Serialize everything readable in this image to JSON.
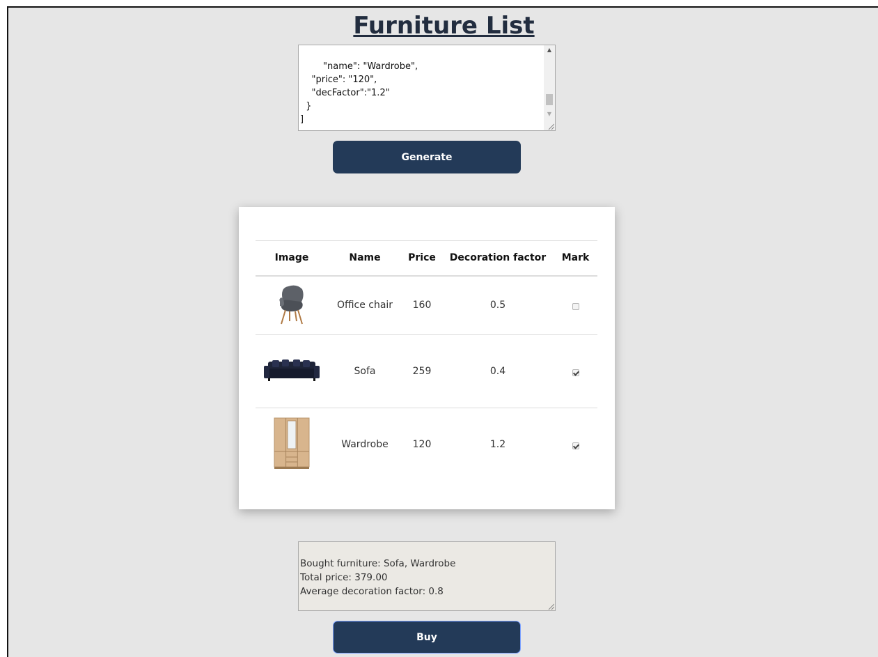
{
  "page": {
    "title": "Furniture List"
  },
  "json_input": {
    "value": "    \"name\": \"Wardrobe\",\n    \"price\": \"120\",\n    \"decFactor\":\"1.2\"\n  }\n]"
  },
  "buttons": {
    "generate_label": "Generate",
    "buy_label": "Buy"
  },
  "table": {
    "headers": [
      "Image",
      "Name",
      "Price",
      "Decoration factor",
      "Mark"
    ],
    "rows": [
      {
        "image": "armchair-image",
        "name": "Office chair",
        "price": "160",
        "decFactor": "0.5",
        "checked": false
      },
      {
        "image": "sofa-image",
        "name": "Sofa",
        "price": "259",
        "decFactor": "0.4",
        "checked": true
      },
      {
        "image": "wardrobe-image",
        "name": "Wardrobe",
        "price": "120",
        "decFactor": "1.2",
        "checked": true
      }
    ]
  },
  "result": {
    "text": "Bought furniture: Sofa, Wardrobe\nTotal price: 379.00\nAverage decoration factor: 0.8"
  },
  "colors": {
    "accent": "#233a58",
    "background": "#e6e6e6"
  }
}
